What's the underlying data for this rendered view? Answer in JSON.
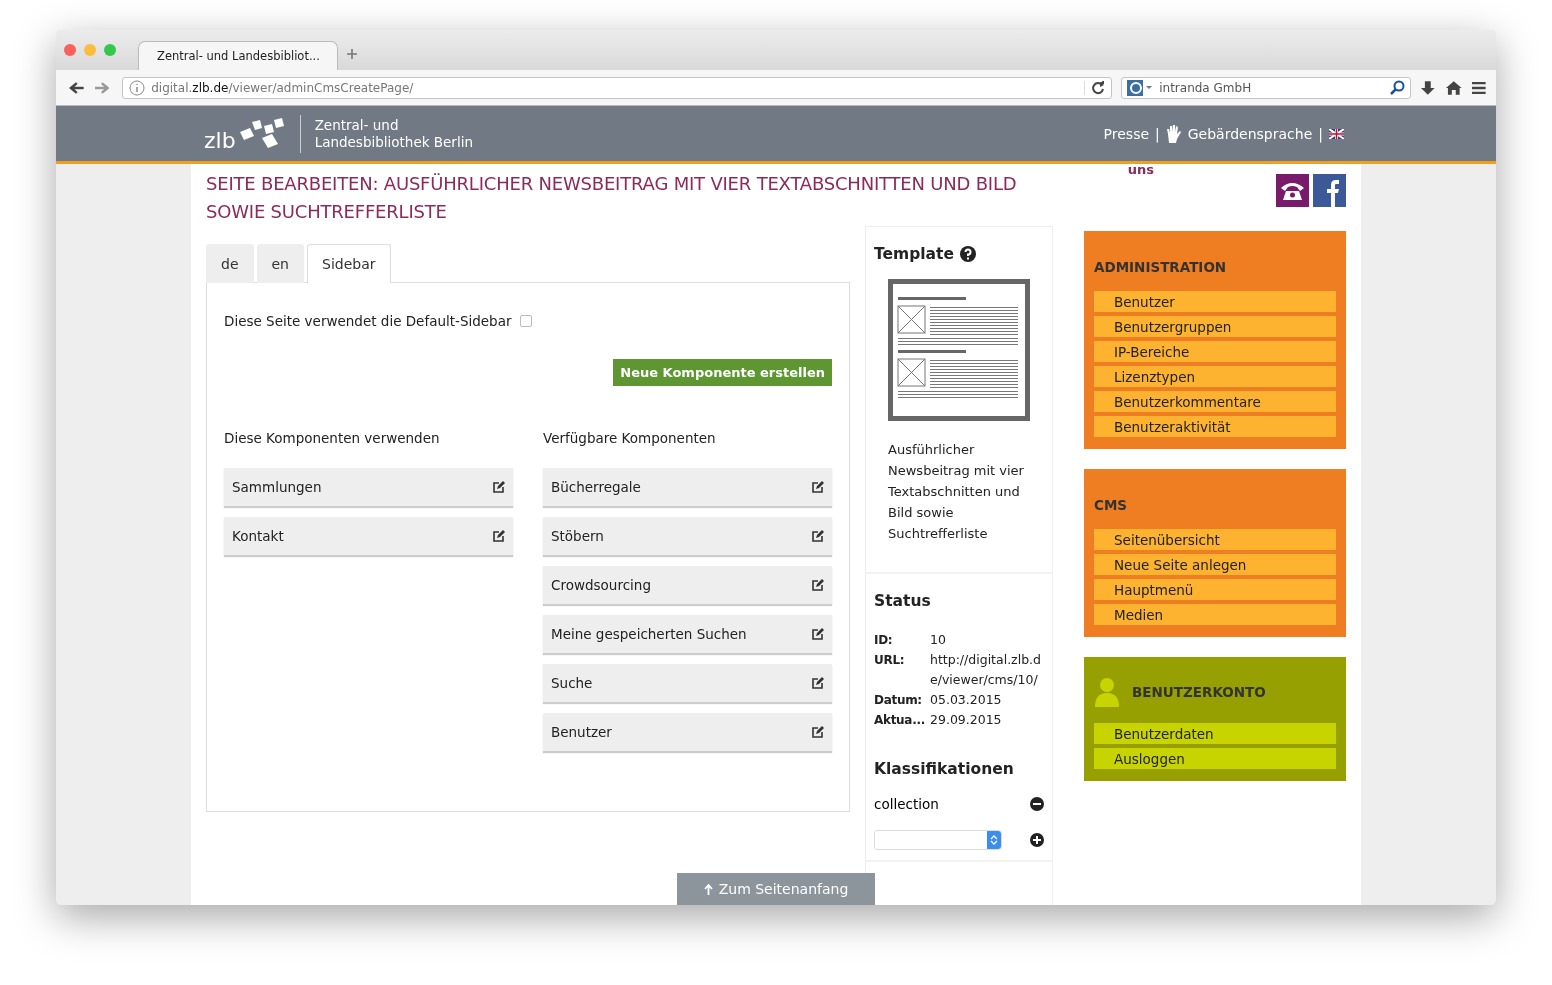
{
  "browser": {
    "tab_title": "Zentral- und Landesbibliot...",
    "url": "digital.**zlb.de**/viewer/adminCmsCreatePage/",
    "search_value": "intranda GmbH"
  },
  "header": {
    "logo_text": "zlb",
    "site_name": [
      "Zentral- und",
      "Landesbibliothek Berlin"
    ],
    "nav": [
      {
        "kind": "link",
        "label": "Presse"
      },
      {
        "kind": "sep",
        "label": "|"
      },
      {
        "kind": "sign-link",
        "label": "Gebärdensprache"
      },
      {
        "kind": "sep",
        "label": "|"
      },
      {
        "kind": "flag"
      }
    ]
  },
  "page": {
    "title": "SEITE BEARBEITEN: AUSFÜHRLICHER NEWSBEITRAG MIT VIER TEXTABSCHNITTEN UND BILD SOWIE SUCHTREFFERLISTE",
    "contact_text": "uns",
    "tabs": [
      {
        "label": "de",
        "selected": false
      },
      {
        "label": "en",
        "selected": false
      },
      {
        "label": "Sidebar",
        "selected": true
      }
    ],
    "default_sidebar": {
      "label": "Diese Seite verwendet die Default-Sidebar",
      "checked": false
    },
    "create_button": "Neue Komponente erstellen",
    "used": {
      "heading": "Diese Komponenten verwenden",
      "items": [
        "Sammlungen",
        "Kontakt"
      ]
    },
    "available": {
      "heading": "Verfügbare Komponenten",
      "items": [
        "Bücherregale",
        "Stöbern",
        "Crowdsourcing",
        "Meine gespeicherten Suchen",
        "Suche",
        "Benutzer"
      ]
    },
    "template": {
      "heading": "Template",
      "caption": "Ausführlicher Newsbeitrag mit vier Textabschnitten und Bild sowie Suchtrefferliste"
    },
    "status": {
      "heading": "Status",
      "rows": [
        {
          "label": "ID:",
          "value": "10"
        },
        {
          "label": "URL:",
          "value": "http://digital.zlb.de/viewer/cms/10/"
        },
        {
          "label": "Datum:",
          "value": "05.03.2015"
        },
        {
          "label": "Aktua...",
          "value": "29.09.2015"
        }
      ]
    },
    "classifications": {
      "heading": "Klassifikationen",
      "items": [
        "collection"
      ]
    },
    "back_to_top": "Zum Seitenanfang"
  },
  "sidebar": [
    {
      "kind": "admin",
      "title": "ADMINISTRATION",
      "items": [
        "Benutzer",
        "Benutzergruppen",
        "IP-Bereiche",
        "Lizenztypen",
        "Benutzerkommentare",
        "Benutzeraktivität"
      ]
    },
    {
      "kind": "cms",
      "title": "CMS",
      "items": [
        "Seitenübersicht",
        "Neue Seite anlegen",
        "Hauptmenü",
        "Medien"
      ]
    },
    {
      "kind": "account",
      "title": "BENUTZERKONTO",
      "items": [
        "Benutzerdaten",
        "Ausloggen"
      ]
    }
  ]
}
